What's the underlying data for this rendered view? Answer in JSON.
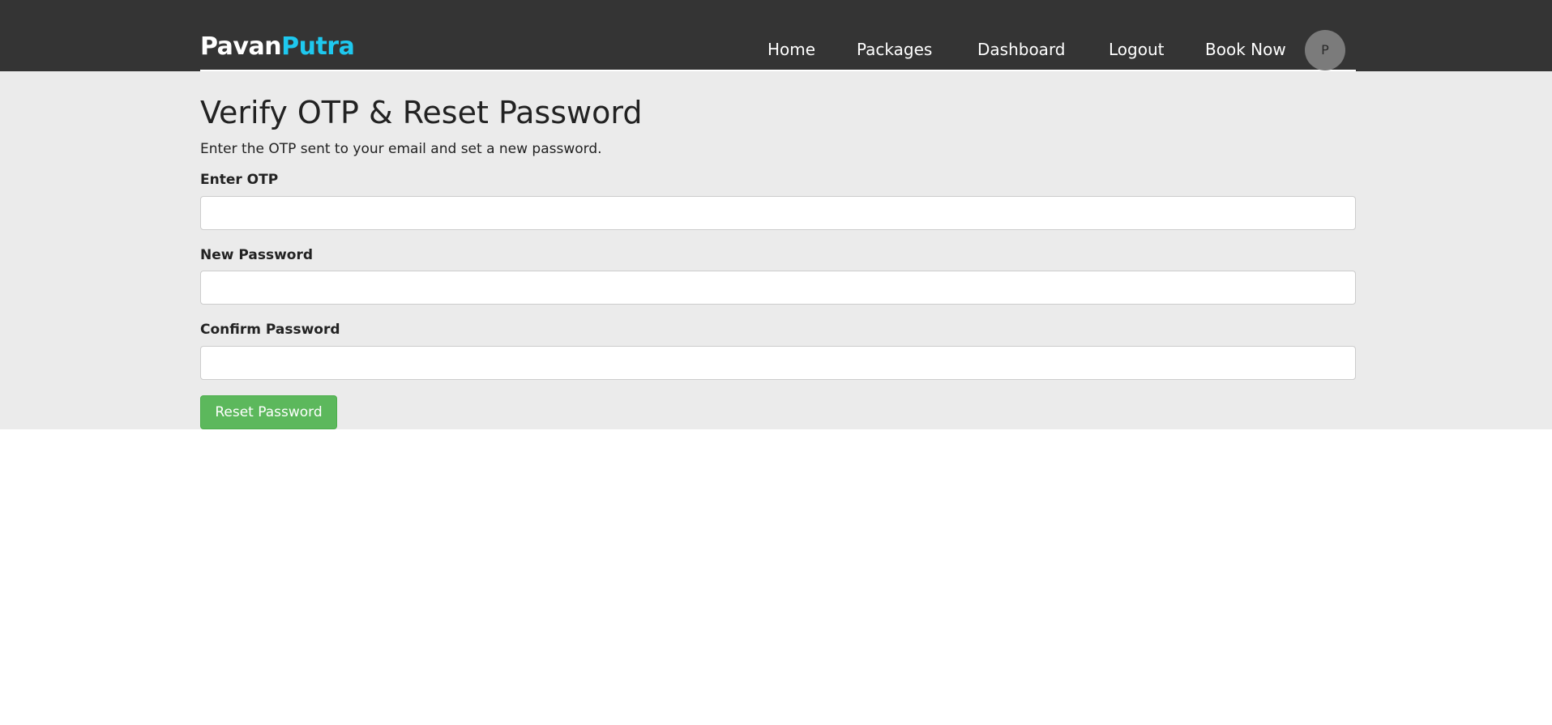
{
  "brand": {
    "part1": "Pavan",
    "part2": "Putra",
    "part1_color": "#ffffff",
    "part2_color": "#1ec8ef"
  },
  "nav": {
    "items": [
      {
        "label": "Home"
      },
      {
        "label": "Packages"
      },
      {
        "label": "Dashboard"
      },
      {
        "label": "Logout"
      },
      {
        "label": "Book Now"
      }
    ],
    "avatar_initial": "P"
  },
  "main": {
    "title": "Verify OTP & Reset Password",
    "subtitle": "Enter the OTP sent to your email and set a new password.",
    "fields": [
      {
        "label": "Enter OTP",
        "value": ""
      },
      {
        "label": "New Password",
        "value": ""
      },
      {
        "label": "Confirm Password",
        "value": ""
      }
    ],
    "submit_label": "Reset Password"
  },
  "colors": {
    "header_bg": "#343434",
    "content_bg": "#ebebeb",
    "accent": "#1ec8ef",
    "button_bg": "#5cb85c"
  }
}
